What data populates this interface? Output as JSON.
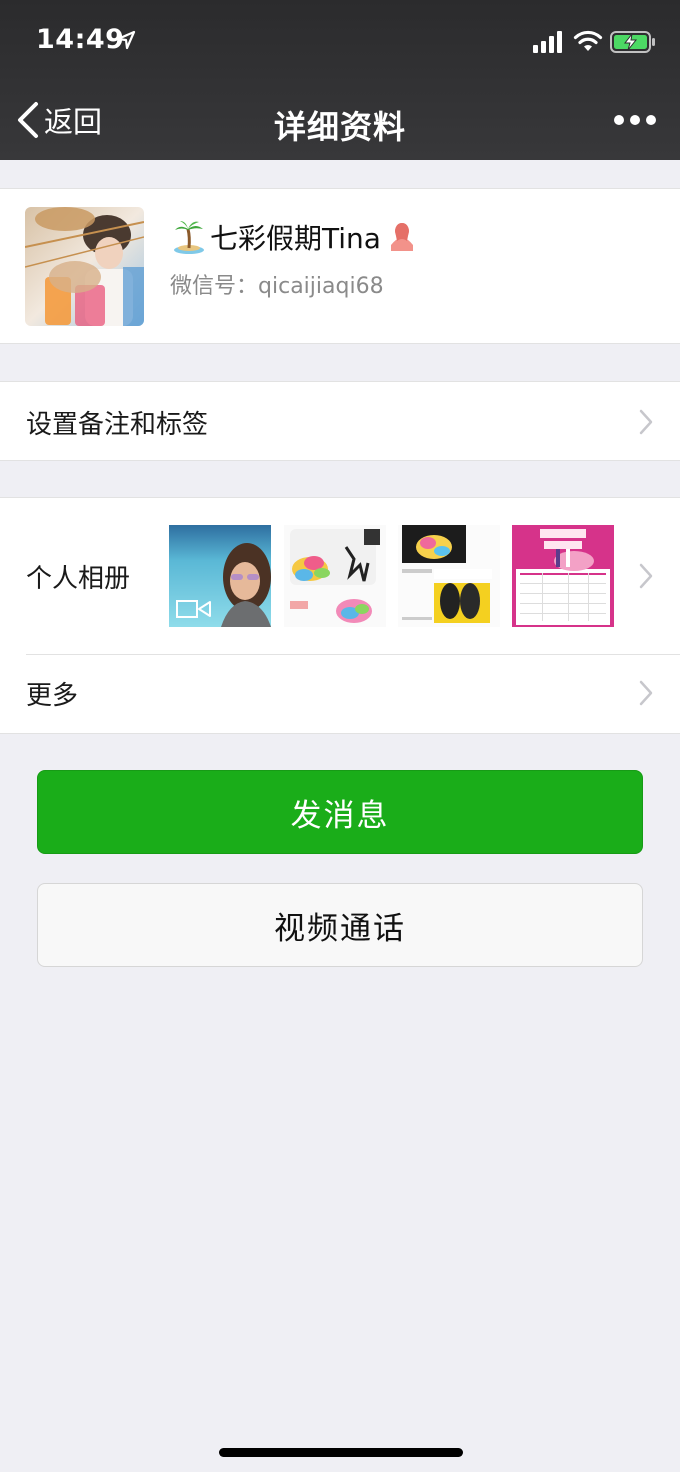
{
  "status_bar": {
    "time": "14:49",
    "icons": [
      "location-arrow-icon",
      "cellular-signal-icon",
      "wifi-icon",
      "battery-charging-icon"
    ]
  },
  "nav": {
    "back_label": "返回",
    "title": "详细资料",
    "more_icon": "more-dots-icon"
  },
  "profile": {
    "name": "七彩假期Tina",
    "name_prefix_icon": "palm-island-icon",
    "name_suffix_icon": "female-icon",
    "wechat_id_label": "微信号：",
    "wechat_id": "qicaijiaqi68"
  },
  "rows": {
    "remark_label": "设置备注和标签",
    "album_label": "个人相册",
    "more_label": "更多"
  },
  "album": {
    "thumbnails": [
      {
        "kind": "video",
        "icon": "video-camera-icon"
      },
      {
        "kind": "image"
      },
      {
        "kind": "image"
      },
      {
        "kind": "image"
      }
    ]
  },
  "buttons": {
    "send_message": "发消息",
    "video_call": "视频通话"
  },
  "colors": {
    "nav_bg": "#333335",
    "page_bg": "#EFEFF4",
    "primary_green": "#1AAD19",
    "secondary_text": "#888888"
  }
}
